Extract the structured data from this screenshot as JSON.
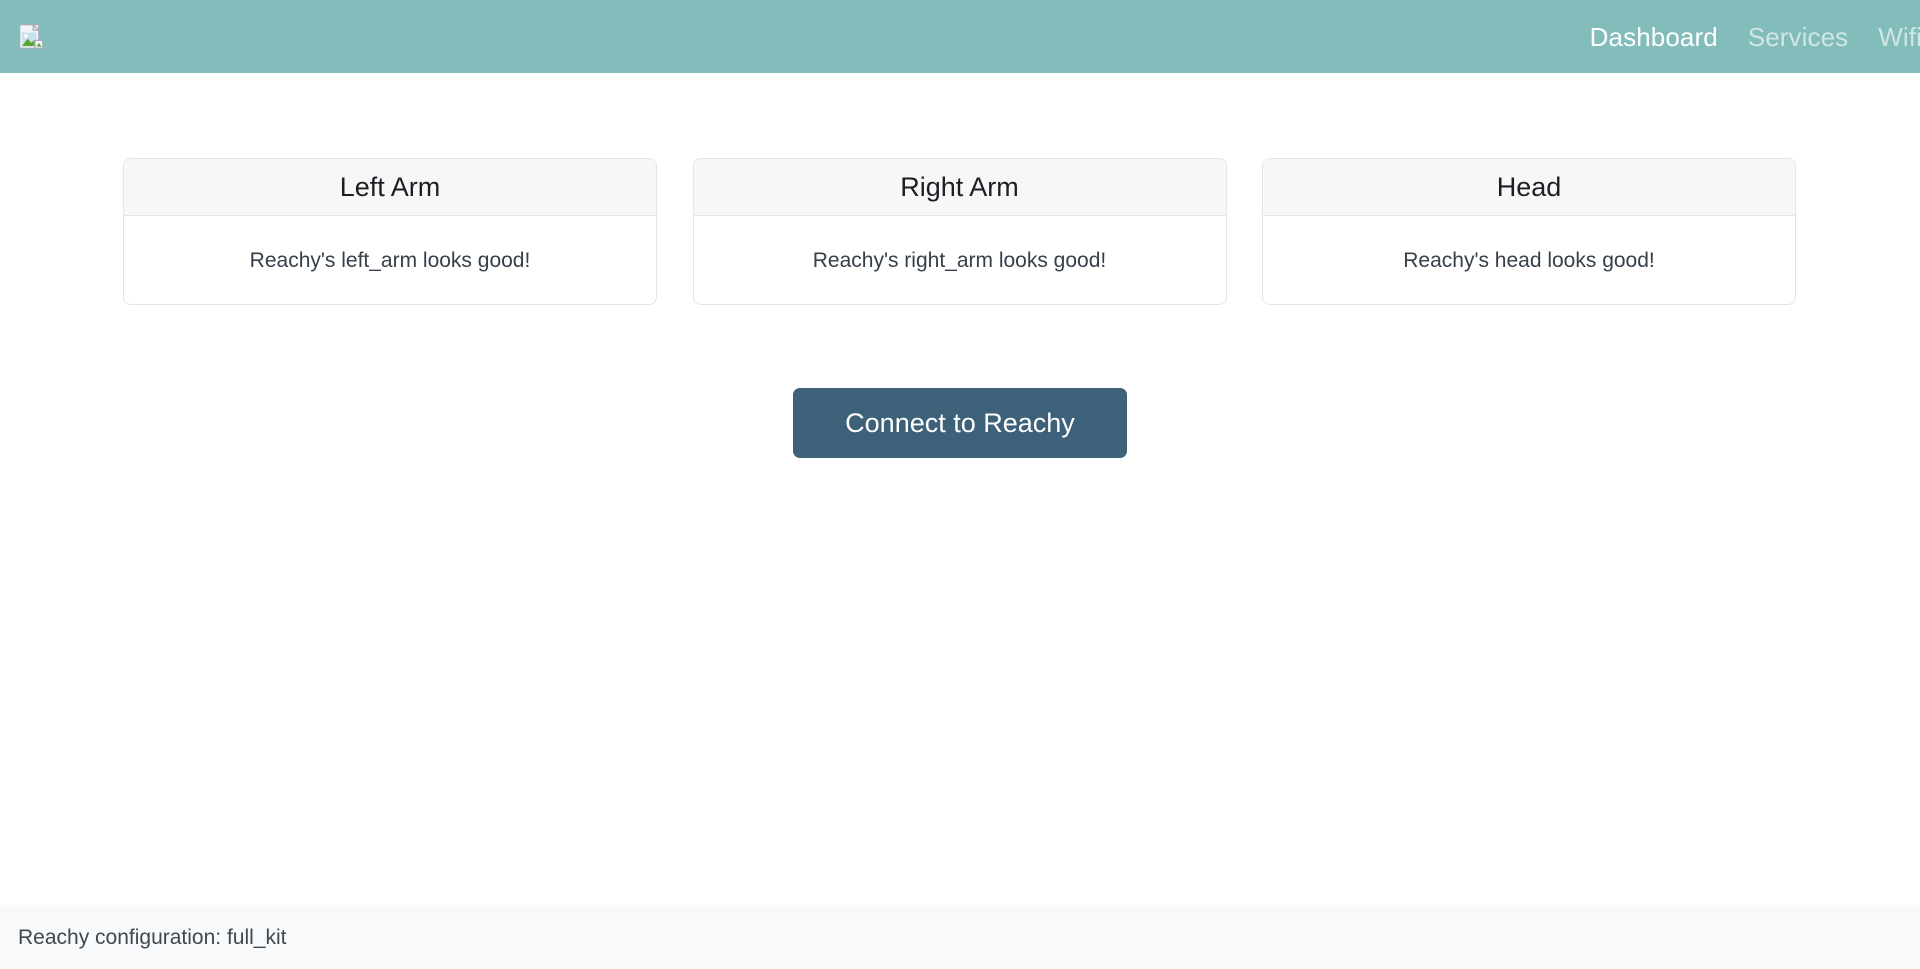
{
  "navbar": {
    "brand_icon": "broken-image-icon",
    "background_color": "#82bdbb",
    "links": [
      {
        "label": "Dashboard",
        "active": true
      },
      {
        "label": "Services",
        "active": false
      },
      {
        "label": "Wifi",
        "active": false
      }
    ]
  },
  "main": {
    "cards": [
      {
        "title": "Left Arm",
        "message": "Reachy's left_arm looks good!"
      },
      {
        "title": "Right Arm",
        "message": "Reachy's right_arm looks good!"
      },
      {
        "title": "Head",
        "message": "Reachy's head looks good!"
      }
    ],
    "connect_button": {
      "label": "Connect to Reachy",
      "color": "#3d6179"
    }
  },
  "footer": {
    "configuration_text": "Reachy configuration: full_kit"
  }
}
